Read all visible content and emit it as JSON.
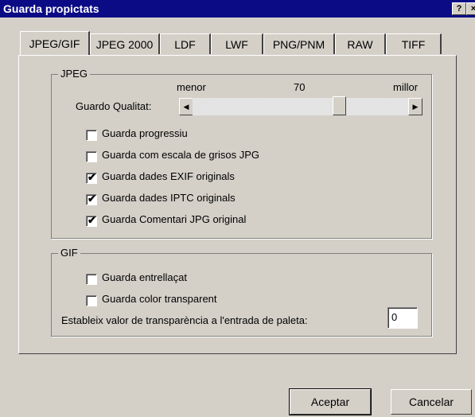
{
  "window": {
    "title": "Guarda propictats",
    "help_btn": "?",
    "close_btn": "×"
  },
  "tabs": [
    {
      "label": "JPEG/GIF",
      "active": true
    },
    {
      "label": "JPEG 2000"
    },
    {
      "label": "LDF"
    },
    {
      "label": "LWF"
    },
    {
      "label": "PNG/PNM"
    },
    {
      "label": "RAW"
    },
    {
      "label": "TIFF"
    }
  ],
  "jpeg": {
    "group_label": "JPEG",
    "quality_label": "Guardo Qualitat:",
    "scale_min": "menor",
    "scale_value": "70",
    "scale_max": "millor",
    "quality_value": 70,
    "options": [
      {
        "label": "Guarda progressiu",
        "checked": false
      },
      {
        "label": "Guarda com escala de grisos JPG",
        "checked": false
      },
      {
        "label": "Guarda dades EXIF originals",
        "checked": true
      },
      {
        "label": "Guarda dades IPTC originals",
        "checked": true
      },
      {
        "label": "Guarda Comentari JPG original",
        "checked": true
      }
    ]
  },
  "gif": {
    "group_label": "GIF",
    "options": [
      {
        "label": "Guarda entrellaçat",
        "checked": false
      },
      {
        "label": "Guarda color transparent",
        "checked": false
      }
    ],
    "transparency_label": "Estableix valor de transparència a l'entrada de paleta:",
    "transparency_value": "0"
  },
  "buttons": {
    "ok": "Aceptar",
    "cancel": "Cancelar"
  },
  "checkmark": "✔"
}
